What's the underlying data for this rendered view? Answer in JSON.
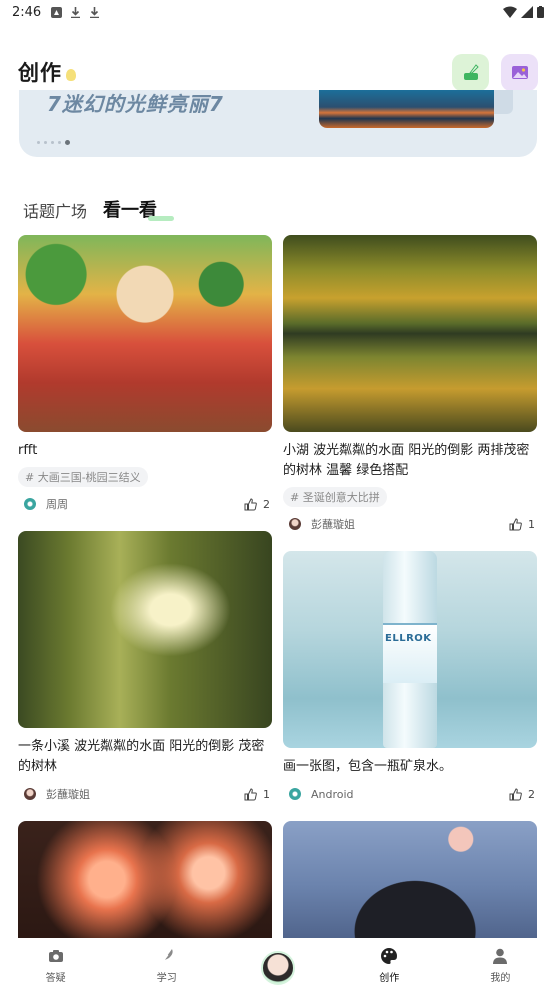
{
  "status_bar": {
    "time": "2:46"
  },
  "header": {
    "title": "创作"
  },
  "banner": {
    "text": "7迷幻的光鲜亮丽7",
    "dot_count": 5,
    "active_dot": 4
  },
  "tabs": [
    {
      "label": "话题广场"
    },
    {
      "label": "看一看"
    }
  ],
  "active_tab": 1,
  "feed": {
    "left": [
      {
        "title": "rfft",
        "tag": "# 大画三国-桃园三结义",
        "author": "周周",
        "likes": "2"
      },
      {
        "title": "一条小溪  波光粼粼的水面  阳光的倒影  茂密的树林",
        "author": "彭蘸璇姐",
        "likes": "1"
      },
      {}
    ],
    "right": [
      {
        "title": "小湖  波光粼粼的水面  阳光的倒影  两排茂密的树林 温馨 绿色搭配",
        "tag": "# 圣诞创意大比拼",
        "author": "彭蘸璇姐",
        "likes": "1"
      },
      {
        "title": "画一张图，包含一瓶矿泉水。",
        "author": "Android",
        "likes": "2",
        "bottle_brand": "ELLROK"
      },
      {}
    ]
  },
  "bottom_nav": [
    {
      "label": "答疑"
    },
    {
      "label": "学习"
    },
    {
      "label": ""
    },
    {
      "label": "创作"
    },
    {
      "label": "我的"
    }
  ],
  "colors": {
    "accent_green": "#b6ecc0",
    "banner_bg": "#e3ebf2",
    "tag_bg": "#f2f3f5"
  }
}
